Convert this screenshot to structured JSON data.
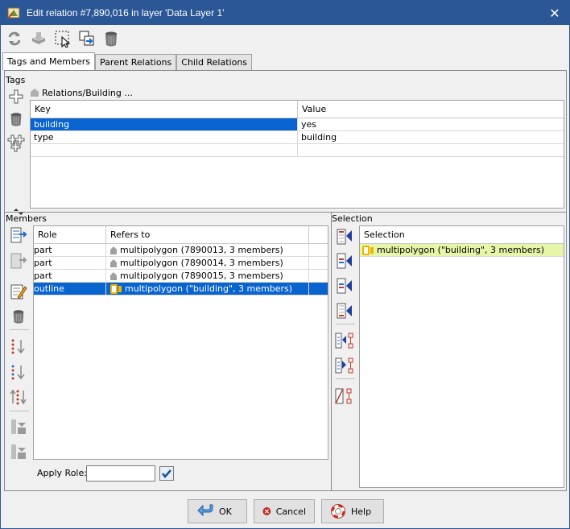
{
  "window": {
    "title": "Edit relation #7,890,016 in layer 'Data Layer 1'",
    "close_symbol": "✕"
  },
  "toolbar": {
    "icons": [
      "refresh-icon",
      "download-icon",
      "select-icon",
      "duplicate-icon",
      "delete-icon"
    ]
  },
  "tabs": [
    {
      "label": "Tags and Members",
      "active": true
    },
    {
      "label": "Parent Relations",
      "active": false
    },
    {
      "label": "Child Relations",
      "active": false
    }
  ],
  "tags": {
    "section_label": "Tags",
    "preset_label": "Relations/Building ...",
    "columns": [
      "Key",
      "Value"
    ],
    "rows": [
      {
        "key": "building",
        "value": "yes",
        "selected": true
      },
      {
        "key": "type",
        "value": "building",
        "selected": false
      },
      {
        "key": "",
        "value": "",
        "selected": false
      }
    ]
  },
  "members": {
    "section_label": "Members",
    "columns": [
      "Role",
      "Refers to"
    ],
    "rows": [
      {
        "role": "part",
        "refers": "multipolygon (7890013, 3 members)",
        "selected": false
      },
      {
        "role": "part",
        "refers": "multipolygon (7890014, 3 members)",
        "selected": false
      },
      {
        "role": "part",
        "refers": "multipolygon (7890015, 3 members)",
        "selected": false
      },
      {
        "role": "outline",
        "refers": "multipolygon (\"building\", 3 members)",
        "selected": true
      }
    ],
    "apply_role_label": "Apply Role:",
    "apply_role_value": ""
  },
  "selection": {
    "section_label": "Selection",
    "column": "Selection",
    "rows": [
      {
        "label": "multipolygon (\"building\", 3 members)"
      }
    ]
  },
  "buttons": {
    "ok": "OK",
    "cancel": "Cancel",
    "help": "Help"
  },
  "colors": {
    "titlebar": "#2b5797",
    "selection": "#0a64d0",
    "selection_highlight": "#e6f6a8"
  }
}
